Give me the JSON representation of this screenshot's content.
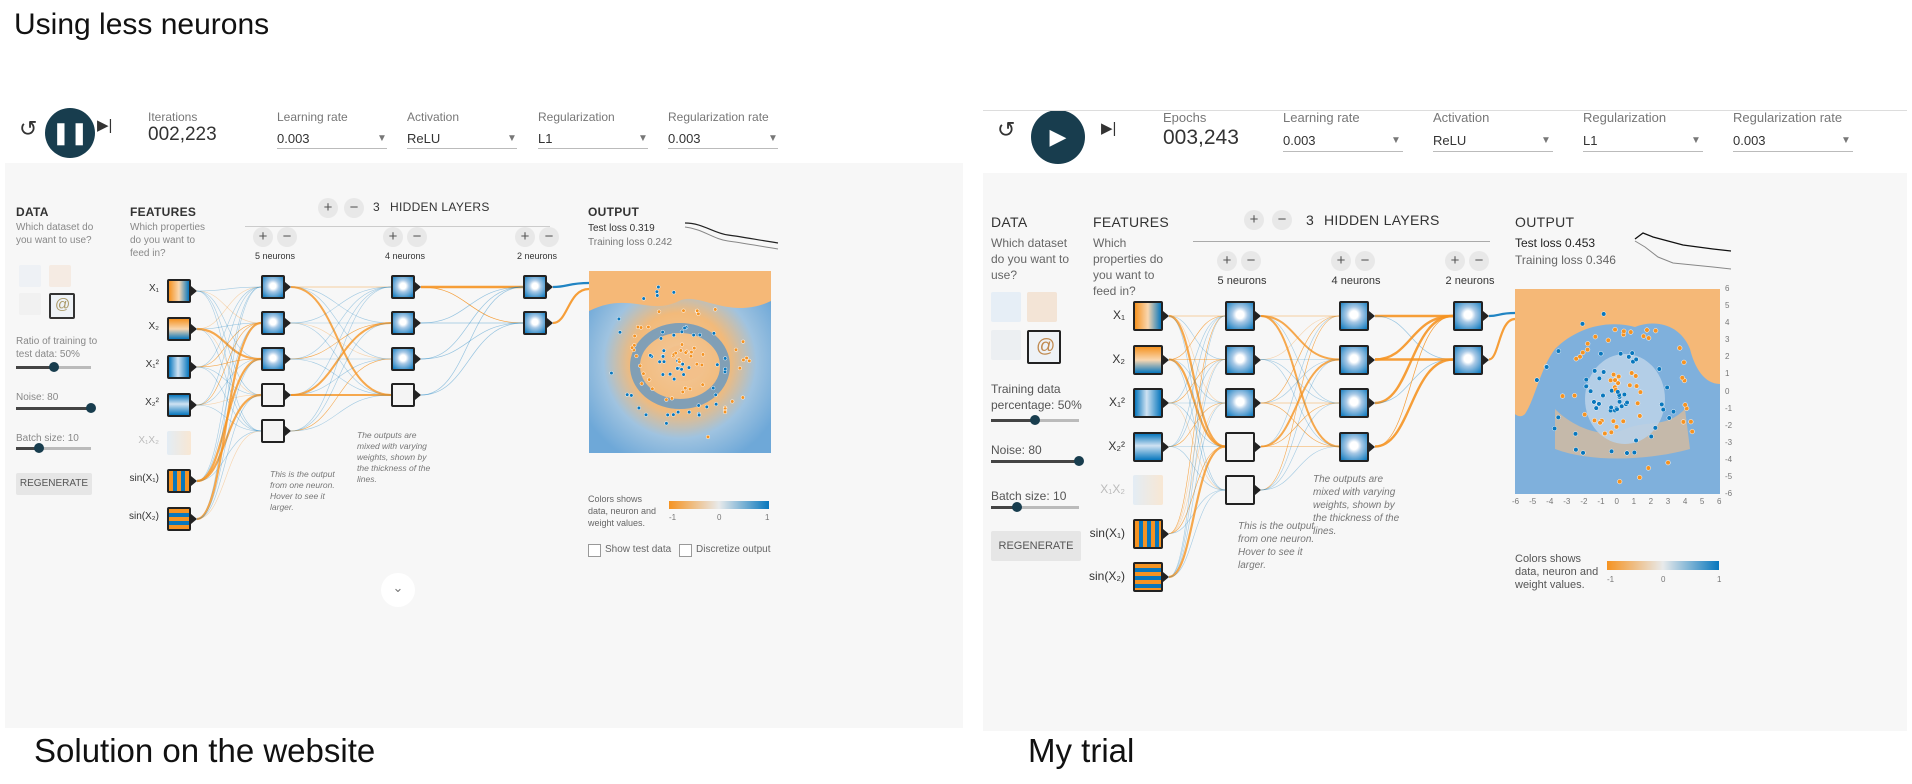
{
  "page_title": "Using less neurons",
  "captions": {
    "left": "Solution on the website",
    "right": "My trial"
  },
  "colors": {
    "accent": "#183d4e",
    "orange": "#f59322",
    "blue": "#0877bd"
  },
  "panels": [
    {
      "playing": true,
      "play_icon": "pause-icon",
      "counter_label": "Iterations",
      "counter_value": "002,223",
      "learning_rate": {
        "label": "Learning rate",
        "value": "0.003"
      },
      "activation": {
        "label": "Activation",
        "value": "ReLU"
      },
      "regularization": {
        "label": "Regularization",
        "value": "L1"
      },
      "regularization_rate": {
        "label": "Regularization rate",
        "value": "0.003"
      },
      "data": {
        "title": "DATA",
        "question": "Which dataset do you want to use?",
        "ratio_label": "Ratio of training to test data:",
        "ratio_value": "50%",
        "ratio_fraction": 0.5,
        "noise_label": "Noise:",
        "noise_value": "80",
        "noise_fraction": 1.0,
        "batch_label": "Batch size:",
        "batch_value": "10",
        "batch_fraction": 0.3,
        "regenerate": "REGENERATE"
      },
      "features": {
        "title": "FEATURES",
        "question": "Which properties do you want to feed in?",
        "items": [
          {
            "label": "X₁",
            "active": true
          },
          {
            "label": "X₂",
            "active": true
          },
          {
            "label": "X₁²",
            "active": true
          },
          {
            "label": "X₂²",
            "active": true
          },
          {
            "label": "X₁X₂",
            "active": false
          },
          {
            "label": "sin(X₁)",
            "active": true
          },
          {
            "label": "sin(X₂)",
            "active": true
          }
        ]
      },
      "hidden": {
        "count": "3",
        "title": "HIDDEN LAYERS",
        "layers": [
          {
            "label": "5 neurons",
            "n": 5
          },
          {
            "label": "4 neurons",
            "n": 4
          },
          {
            "label": "2 neurons",
            "n": 2
          }
        ]
      },
      "annotation_neuron": "This is the output from one neuron. Hover to see it larger.",
      "annotation_weights": "The outputs are mixed with varying weights, shown by the thickness of the lines.",
      "output": {
        "title": "OUTPUT",
        "test_loss": "Test loss 0.319",
        "training_loss": "Training loss 0.242",
        "colors_note": "Colors shows data, neuron and weight values.",
        "scale": [
          "-1",
          "0",
          "1"
        ],
        "show_test_data": "Show test data",
        "discretize": "Discretize output"
      }
    },
    {
      "playing": false,
      "play_icon": "play-icon",
      "counter_label": "Epochs",
      "counter_value": "003,243",
      "learning_rate": {
        "label": "Learning rate",
        "value": "0.003"
      },
      "activation": {
        "label": "Activation",
        "value": "ReLU"
      },
      "regularization": {
        "label": "Regularization",
        "value": "L1"
      },
      "regularization_rate": {
        "label": "Regularization rate",
        "value": "0.003"
      },
      "data": {
        "title": "DATA",
        "question": "Which dataset do you want to use?",
        "ratio_label": "Training data percentage:",
        "ratio_value": "50%",
        "ratio_fraction": 0.5,
        "noise_label": "Noise:",
        "noise_value": "80",
        "noise_fraction": 1.0,
        "batch_label": "Batch size:",
        "batch_value": "10",
        "batch_fraction": 0.3,
        "regenerate": "REGENERATE"
      },
      "features": {
        "title": "FEATURES",
        "question": "Which properties do you want to feed in?",
        "items": [
          {
            "label": "X₁",
            "active": true
          },
          {
            "label": "X₂",
            "active": true
          },
          {
            "label": "X₁²",
            "active": true
          },
          {
            "label": "X₂²",
            "active": true
          },
          {
            "label": "X₁X₂",
            "active": false
          },
          {
            "label": "sin(X₁)",
            "active": true
          },
          {
            "label": "sin(X₂)",
            "active": true
          }
        ]
      },
      "hidden": {
        "count": "3",
        "title": "HIDDEN LAYERS",
        "layers": [
          {
            "label": "5 neurons",
            "n": 5
          },
          {
            "label": "4 neurons",
            "n": 4
          },
          {
            "label": "2 neurons",
            "n": 2
          }
        ]
      },
      "annotation_neuron": "This is the output from one neuron. Hover to see it larger.",
      "annotation_weights": "The outputs are mixed with varying weights, shown by the thickness of the lines.",
      "output": {
        "title": "OUTPUT",
        "test_loss": "Test loss 0.453",
        "training_loss": "Training loss 0.346",
        "colors_note": "Colors shows data, neuron and weight values.",
        "scale": [
          "-1",
          "0",
          "1"
        ],
        "axis_ticks": [
          "-6",
          "-5",
          "-4",
          "-3",
          "-2",
          "-1",
          "0",
          "1",
          "2",
          "3",
          "4",
          "5",
          "6"
        ]
      }
    }
  ]
}
